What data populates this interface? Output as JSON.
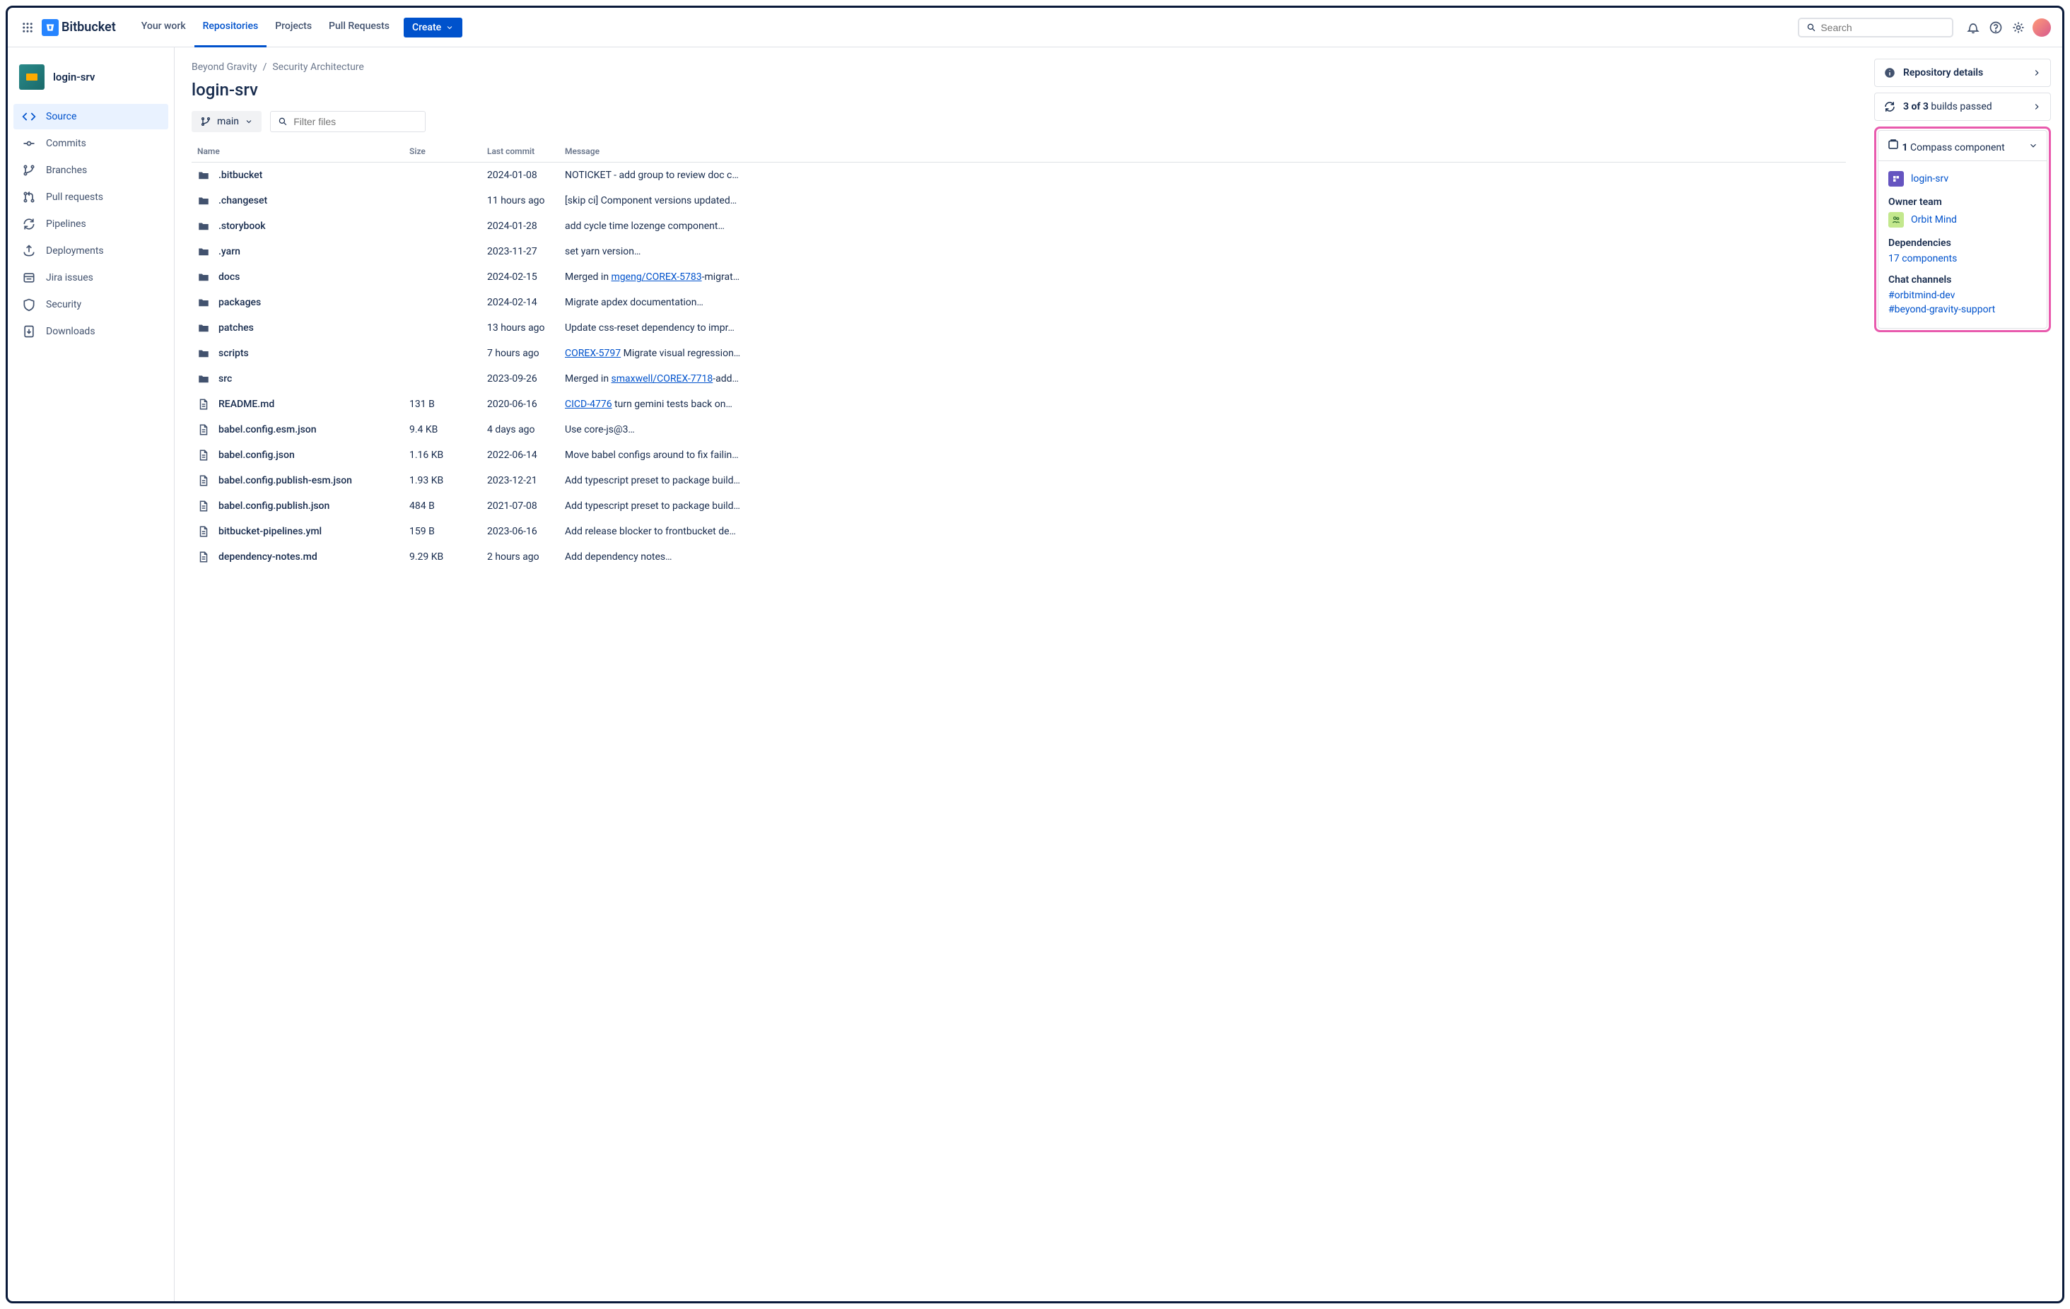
{
  "topbar": {
    "product": "Bitbucket",
    "nav": [
      "Your work",
      "Repositories",
      "Projects",
      "Pull Requests"
    ],
    "active_nav": 1,
    "create_label": "Create",
    "search_placeholder": "Search"
  },
  "sidebar": {
    "repo_name": "login-srv",
    "items": [
      {
        "label": "Source",
        "icon": "code"
      },
      {
        "label": "Commits",
        "icon": "commit"
      },
      {
        "label": "Branches",
        "icon": "branch"
      },
      {
        "label": "Pull requests",
        "icon": "pr"
      },
      {
        "label": "Pipelines",
        "icon": "pipeline"
      },
      {
        "label": "Deployments",
        "icon": "deploy"
      },
      {
        "label": "Jira issues",
        "icon": "jira"
      },
      {
        "label": "Security",
        "icon": "shield"
      },
      {
        "label": "Downloads",
        "icon": "download"
      }
    ],
    "active_index": 0
  },
  "breadcrumb": [
    "Beyond Gravity",
    "Security Architecture"
  ],
  "page_title": "login-srv",
  "branch_selector": "main",
  "filter_placeholder": "Filter files",
  "table": {
    "headers": [
      "Name",
      "Size",
      "Last commit",
      "Message"
    ],
    "rows": [
      {
        "type": "folder",
        "name": ".bitbucket",
        "size": "",
        "commit": "2024-01-08",
        "message": "NOTICKET - add group to review doc c…"
      },
      {
        "type": "folder",
        "name": ".changeset",
        "size": "",
        "commit": "11 hours ago",
        "message": "[skip ci] Component versions updated…"
      },
      {
        "type": "folder",
        "name": ".storybook",
        "size": "",
        "commit": "2024-01-28",
        "message": "add cycle time lozenge component…"
      },
      {
        "type": "folder",
        "name": ".yarn",
        "size": "",
        "commit": "2023-11-27",
        "message": "set yarn version…"
      },
      {
        "type": "folder",
        "name": "docs",
        "size": "",
        "commit": "2024-02-15",
        "message_pre": "Merged in ",
        "link_a": "mgeng/",
        "link_b": "COREX-5783",
        "message_post": "-migrat…"
      },
      {
        "type": "folder",
        "name": "packages",
        "size": "",
        "commit": "2024-02-14",
        "message": "Migrate apdex documentation…"
      },
      {
        "type": "folder",
        "name": "patches",
        "size": "",
        "commit": "13 hours ago",
        "message": "Update css-reset dependency to impr…"
      },
      {
        "type": "folder",
        "name": "scripts",
        "size": "",
        "commit": "7 hours ago",
        "link_b": "COREX-5797",
        "message_post": " Migrate visual regression…"
      },
      {
        "type": "folder",
        "name": "src",
        "size": "",
        "commit": "2023-09-26",
        "message_pre": "Merged in ",
        "link_a": "smaxwell/",
        "link_b": "COREX-7718",
        "message_post": "-add…"
      },
      {
        "type": "file",
        "name": "README.md",
        "size": "131 B",
        "commit": "2020-06-16",
        "link_b": "CICD-4776",
        "message_post": " turn gemini tests back on…"
      },
      {
        "type": "file",
        "name": "babel.config.esm.json",
        "size": "9.4 KB",
        "commit": "4 days ago",
        "message": "Use core-js@3…"
      },
      {
        "type": "file",
        "name": "babel.config.json",
        "size": "1.16 KB",
        "commit": "2022-06-14",
        "message": "Move babel configs around to fix failin…"
      },
      {
        "type": "file",
        "name": "babel.config.publish-esm.json",
        "size": "1.93 KB",
        "commit": "2023-12-21",
        "message": "Add typescript preset to package build…"
      },
      {
        "type": "file",
        "name": "babel.config.publish.json",
        "size": "484 B",
        "commit": "2021-07-08",
        "message": "Add typescript preset to package build…"
      },
      {
        "type": "file",
        "name": "bitbucket-pipelines.yml",
        "size": "159 B",
        "commit": "2023-06-16",
        "message": "Add release blocker to frontbucket de…"
      },
      {
        "type": "file",
        "name": "dependency-notes.md",
        "size": "9.29 KB",
        "commit": "2 hours ago",
        "message": "Add dependency notes…"
      }
    ]
  },
  "rightbar": {
    "details_label": "Repository details",
    "builds_pre": "3 of 3",
    "builds_post": " builds passed",
    "compass_pre": "1",
    "compass_post": " Compass component",
    "component_name": "login-srv",
    "owner_label": "Owner team",
    "owner_team": "Orbit Mind",
    "deps_label": "Dependencies",
    "deps_link": "17 components",
    "chat_label": "Chat channels",
    "chat_1": "#orbitmind-dev",
    "chat_2": "#beyond-gravity-support"
  }
}
